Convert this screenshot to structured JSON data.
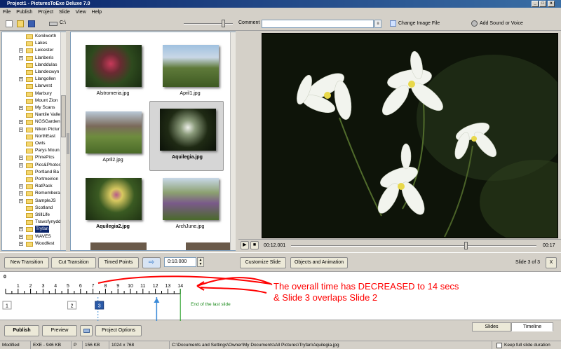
{
  "window": {
    "title": "Project1 - PicturesToExe Deluxe 7.0",
    "min": "_",
    "max": "□",
    "close": "x"
  },
  "menu": [
    "File",
    "Publish",
    "Project",
    "Slide",
    "View",
    "Help"
  ],
  "toolbar": {
    "drive": "C:\\",
    "comment_label": "Comment",
    "comment_value": "",
    "change_image": "Change Image File",
    "add_sound": "Add Sound or Voice"
  },
  "tree": [
    {
      "label": "Kenilworth",
      "plus": false
    },
    {
      "label": "Lakes",
      "plus": false
    },
    {
      "label": "Leicester",
      "plus": true
    },
    {
      "label": "Llanberis",
      "plus": true
    },
    {
      "label": "Llanddulas",
      "plus": false
    },
    {
      "label": "Llandecwyn",
      "plus": false
    },
    {
      "label": "Llangollen",
      "plus": true
    },
    {
      "label": "Llanwrst",
      "plus": false
    },
    {
      "label": "Marbury",
      "plus": false
    },
    {
      "label": "Mount Zion",
      "plus": false
    },
    {
      "label": "My Scans",
      "plus": true
    },
    {
      "label": "Nantile Valle",
      "plus": false
    },
    {
      "label": "NGSGardens",
      "plus": true
    },
    {
      "label": "Nikon Pictur",
      "plus": true
    },
    {
      "label": "NorthEast",
      "plus": false
    },
    {
      "label": "Owls",
      "plus": false
    },
    {
      "label": "Parys Moun",
      "plus": false
    },
    {
      "label": "PhnePics",
      "plus": true
    },
    {
      "label": "Pics&Photos",
      "plus": true
    },
    {
      "label": "Portland Ba",
      "plus": false
    },
    {
      "label": "Portmeirion",
      "plus": false
    },
    {
      "label": "RatPack",
      "plus": true
    },
    {
      "label": "Remembera",
      "plus": true
    },
    {
      "label": "SampleJS",
      "plus": true
    },
    {
      "label": "Scotland",
      "plus": false
    },
    {
      "label": "StillLife",
      "plus": false
    },
    {
      "label": "Trawsfynydd",
      "plus": false
    },
    {
      "label": "Tryfan",
      "plus": true,
      "selected": true
    },
    {
      "label": "WAVES",
      "plus": true
    },
    {
      "label": "Woodfest",
      "plus": true
    }
  ],
  "thumbs": [
    {
      "file": "Alstromeria.jpg",
      "bold": false,
      "selected": false
    },
    {
      "file": "April1.jpg",
      "bold": false,
      "selected": false
    },
    {
      "file": "April2.jpg",
      "bold": false,
      "selected": false
    },
    {
      "file": "Aquilegia.jpg",
      "bold": true,
      "selected": true
    },
    {
      "file": "Aquilegia2.jpg",
      "bold": true,
      "selected": false
    },
    {
      "file": "ArchJune.jpg",
      "bold": false,
      "selected": false
    }
  ],
  "player": {
    "current": "00:12.001",
    "total": "00:17",
    "progress_fraction": 0.71
  },
  "buttons": {
    "new_transition": "New Transition",
    "cut_transition": "Cut Transition",
    "timed_points": "Timed Points",
    "time_value": "0:10.000",
    "customize_slide": "Customize Slide",
    "objects_animation": "Objects and Animation",
    "slide_counter": "Slide 3 of 3",
    "close_x": "X"
  },
  "timeline": {
    "start": "0",
    "ticks": [
      "1",
      "2",
      "3",
      "4",
      "5",
      "6",
      "7",
      "8",
      "9",
      "10",
      "11",
      "12",
      "13",
      "14"
    ],
    "slides": [
      "1",
      "2",
      "3"
    ],
    "end_label": "End of the last slide",
    "annotation_line1": "The overall time has DECREASED to 14 secs",
    "annotation_line2": "& Slide 3 overlaps Slide 2",
    "annotation_color": "#ff0000"
  },
  "bottom": {
    "publish": "Publish",
    "preview": "Preview",
    "project_options": "Project Options",
    "tab_slides": "Slides",
    "tab_timeline": "Timeline"
  },
  "status": {
    "state": "Modified",
    "exe": "EXE - 946 KB",
    "p": "P",
    "size": "156 KB",
    "dims": "1024 x 768",
    "path": "C:\\Documents and Settings\\Owner\\My Documents\\All Pictures\\Tryfan\\Aquilegia.jpg",
    "keep_full": "Keep full slide duration"
  }
}
